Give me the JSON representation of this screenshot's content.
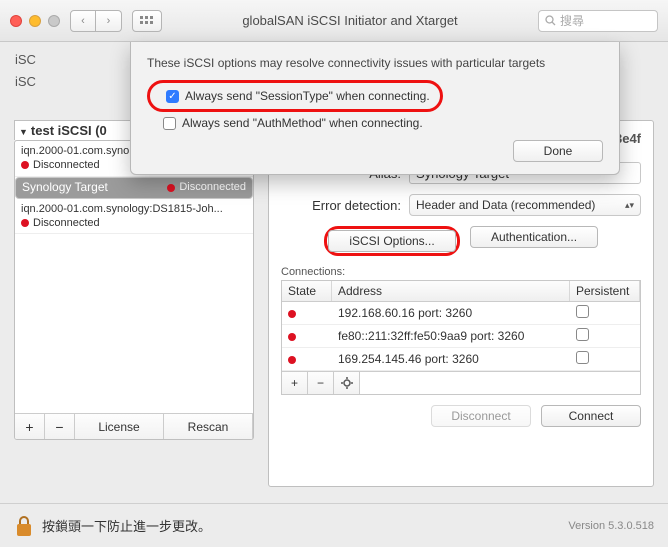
{
  "titlebar": {
    "title": "globalSAN iSCSI Initiator and Xtarget",
    "search_placeholder": "搜尋"
  },
  "tabs": {
    "t1": "iSC",
    "t2": "iSC"
  },
  "sidebar": {
    "header": "test iSCSI (0",
    "items": [
      {
        "iqn": "iqn.2000-01.com.synology:DS1815-Jon...",
        "status": "Disconnected"
      },
      {
        "iqn": "Synology Target",
        "status": "Disconnected"
      },
      {
        "iqn": "iqn.2000-01.com.synology:DS1815-Joh...",
        "status": "Disconnected"
      }
    ],
    "license": "License",
    "rescan": "Rescan"
  },
  "right": {
    "hash": "3c3633e4f",
    "alias_label": "Alias:",
    "alias_value": "Synology Target",
    "err_label": "Error detection:",
    "err_value": "Header and Data (recommended)",
    "iscsi_btn": "iSCSI Options...",
    "auth_btn": "Authentication...",
    "conns_label": "Connections:",
    "cols": {
      "state": "State",
      "address": "Address",
      "persistent": "Persistent"
    },
    "rows": [
      {
        "address": "192.168.60.16 port: 3260"
      },
      {
        "address": "fe80::211:32ff:fe50:9aa9 port: 3260"
      },
      {
        "address": "169.254.145.46 port: 3260"
      }
    ],
    "disconnect": "Disconnect",
    "connect": "Connect"
  },
  "bottom": {
    "lock_text": "按鎖頭一下防止進一步更改。",
    "version": "Version 5.3.0.518"
  },
  "popup": {
    "hint": "These iSCSI options may resolve connectivity issues with particular targets",
    "opt1": "Always send \"SessionType\" when connecting.",
    "opt2": "Always send \"AuthMethod\" when connecting.",
    "done": "Done"
  }
}
